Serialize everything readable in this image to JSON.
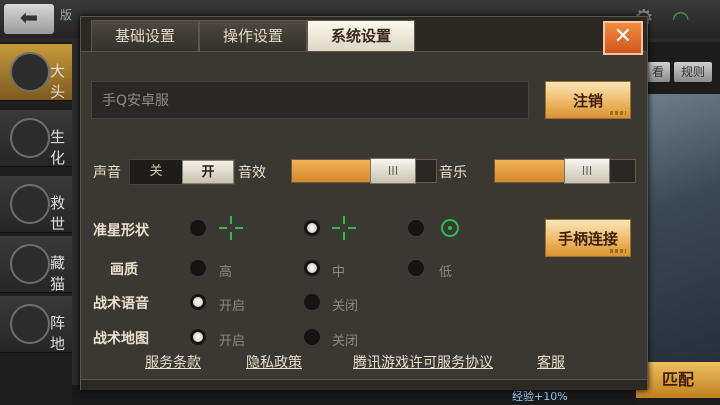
{
  "background": {
    "version_text": "版",
    "left_modes": [
      {
        "label": "大头",
        "selected": true
      },
      {
        "label": "生化",
        "selected": false
      },
      {
        "label": "救世",
        "selected": false
      },
      {
        "label": "藏猫",
        "selected": false
      },
      {
        "label": "阵地",
        "selected": false
      }
    ],
    "right_buttons": [
      "看",
      "规则"
    ],
    "match_button": "匹配",
    "bonus_text": "经验+10%"
  },
  "dialog": {
    "tabs": [
      {
        "label": "基础设置",
        "active": false
      },
      {
        "label": "操作设置",
        "active": false
      },
      {
        "label": "系统设置",
        "active": true
      }
    ],
    "close_label": "✕",
    "server_name": "手Q安卓服",
    "logout_label": "注销",
    "sound": {
      "label": "声音",
      "off_label": "关",
      "on_label": "开",
      "value": "开"
    },
    "sfx": {
      "label": "音效",
      "level": 0.78,
      "thumb_label": "III"
    },
    "music": {
      "label": "音乐",
      "level": 0.72,
      "thumb_label": "III"
    },
    "crosshair": {
      "label": "准星形状",
      "selected_index": 1,
      "options": [
        "cross",
        "cross",
        "circle-dot"
      ]
    },
    "gamepad_label": "手柄连接",
    "quality": {
      "label": "画质",
      "options": [
        "高",
        "中",
        "低"
      ],
      "selected_index": 1
    },
    "voice": {
      "label": "战术语音",
      "options": [
        "开启",
        "关闭"
      ],
      "selected_index": 0
    },
    "map": {
      "label": "战术地图",
      "options": [
        "开启",
        "关闭"
      ],
      "selected_index": 0
    },
    "links": [
      "服务条款",
      "隐私政策",
      "腾讯游戏许可服务协议",
      "客服"
    ]
  },
  "colors": {
    "accent": "#e8a348",
    "crosshair": "#27c24a",
    "close": "#e5702b"
  }
}
